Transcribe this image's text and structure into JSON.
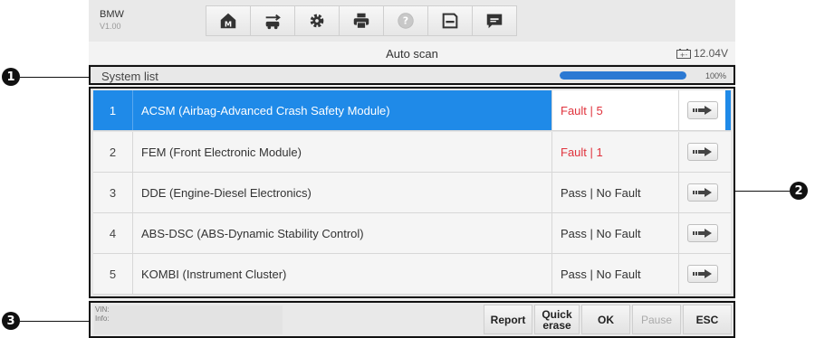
{
  "header": {
    "make": "BMW",
    "version": "V1.00"
  },
  "toolbar": [
    {
      "name": "home-icon"
    },
    {
      "name": "vehicle-swap-icon"
    },
    {
      "name": "settings-icon"
    },
    {
      "name": "print-icon"
    },
    {
      "name": "help-icon"
    },
    {
      "name": "save-icon"
    },
    {
      "name": "message-icon"
    }
  ],
  "titlebar": {
    "title": "Auto scan",
    "battery": "12.04V"
  },
  "system_list": {
    "label": "System list",
    "progress_percent": 100,
    "progress_text": "100%"
  },
  "systems": [
    {
      "index": "1",
      "name": "ACSM (Airbag-Advanced Crash Safety Module)",
      "status": "Fault | 5",
      "fault": true,
      "selected": true
    },
    {
      "index": "2",
      "name": "FEM (Front Electronic Module)",
      "status": "Fault | 1",
      "fault": true,
      "selected": false
    },
    {
      "index": "3",
      "name": "DDE (Engine-Diesel Electronics)",
      "status": "Pass | No Fault",
      "fault": false,
      "selected": false
    },
    {
      "index": "4",
      "name": "ABS-DSC (ABS-Dynamic Stability Control)",
      "status": "Pass | No Fault",
      "fault": false,
      "selected": false
    },
    {
      "index": "5",
      "name": "KOMBI (Instrument Cluster)",
      "status": "Pass | No Fault",
      "fault": false,
      "selected": false
    }
  ],
  "footer": {
    "vin_label": "VIN:",
    "info_label": "Info:",
    "buttons": [
      {
        "label": "Report",
        "enabled": true
      },
      {
        "label": "Quick erase",
        "enabled": true
      },
      {
        "label": "OK",
        "enabled": true
      },
      {
        "label": "Pause",
        "enabled": false
      },
      {
        "label": "ESC",
        "enabled": true
      }
    ]
  },
  "callouts": [
    "1",
    "2",
    "3"
  ],
  "colors": {
    "accent": "#1f8ae8",
    "fault": "#e0333d",
    "progress": "#2b79d3"
  }
}
